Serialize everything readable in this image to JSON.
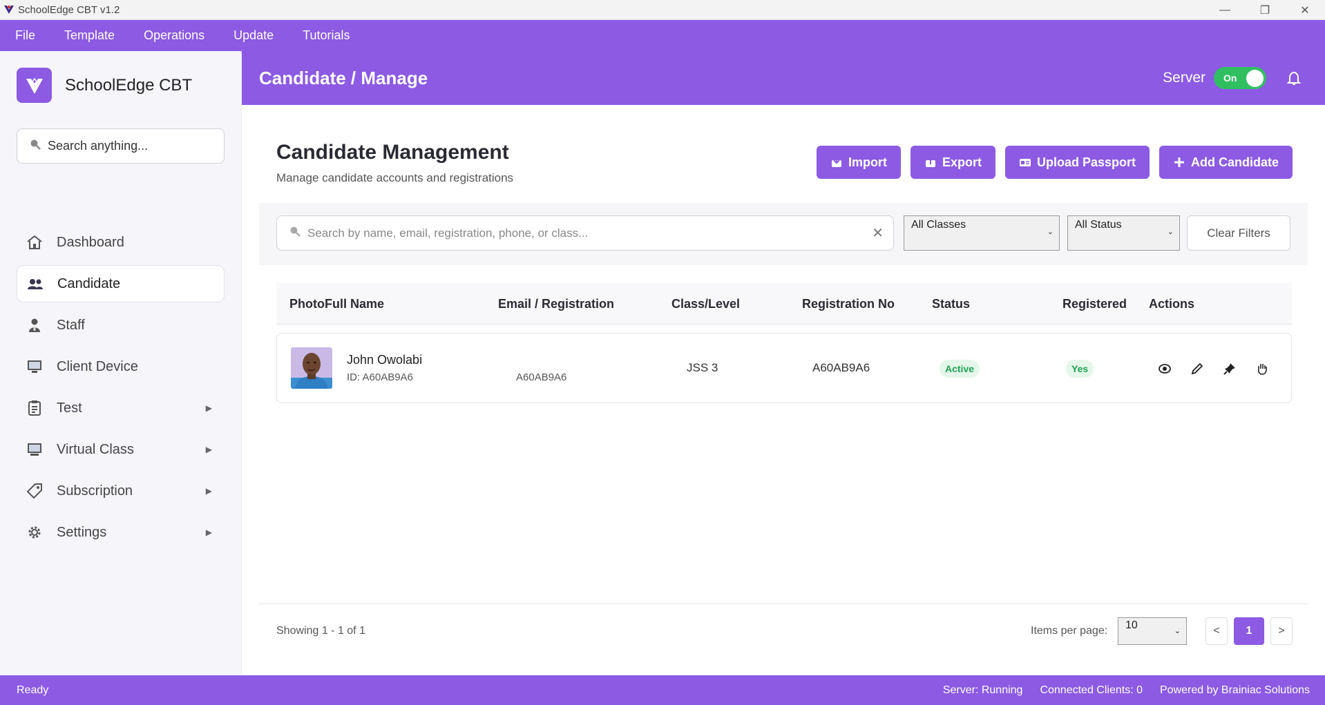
{
  "window": {
    "title": "SchoolEdge CBT v1.2",
    "controls": {
      "minimize": "—",
      "maximize": "❐",
      "close": "✕"
    }
  },
  "menu": [
    "File",
    "Template",
    "Operations",
    "Update",
    "Tutorials"
  ],
  "sidebar": {
    "brand": "SchoolEdge CBT",
    "search_placeholder": "Search anything...",
    "items": [
      {
        "label": "Dashboard",
        "icon": "home-icon",
        "has_submenu": false
      },
      {
        "label": "Candidate",
        "icon": "users-icon",
        "has_submenu": false,
        "active": true
      },
      {
        "label": "Staff",
        "icon": "staff-icon",
        "has_submenu": false
      },
      {
        "label": "Client Device",
        "icon": "monitor-icon",
        "has_submenu": false
      },
      {
        "label": "Test",
        "icon": "clipboard-icon",
        "has_submenu": true
      },
      {
        "label": "Virtual Class",
        "icon": "screen-icon",
        "has_submenu": true
      },
      {
        "label": "Subscription",
        "icon": "tag-icon",
        "has_submenu": true
      },
      {
        "label": "Settings",
        "icon": "gear-icon",
        "has_submenu": true
      }
    ],
    "submenu_arrow": "▶"
  },
  "header": {
    "title": "Candidate / Manage",
    "server_label": "Server",
    "toggle_text": "On"
  },
  "main": {
    "title": "Candidate Management",
    "subtitle": "Manage candidate accounts and registrations",
    "buttons": {
      "import": "Import",
      "export": "Export",
      "upload_passport": "Upload Passport",
      "add_candidate": "Add Candidate"
    },
    "filters": {
      "search_placeholder": "Search by name, email, registration, phone, or class...",
      "class_select": "All Classes",
      "status_select": "All Status",
      "clear": "Clear Filters"
    },
    "table": {
      "headers": [
        "PhotoFull Name",
        "Email / Registration",
        "Class/Level",
        "Registration No",
        "Status",
        "Registered",
        "Actions"
      ],
      "rows": [
        {
          "name": "John Owolabi",
          "id": "ID: A60AB9A6",
          "email_reg": "A60AB9A6",
          "class": "JSS 3",
          "reg_no": "A60AB9A6",
          "status": "Active",
          "registered": "Yes"
        }
      ]
    },
    "pagination": {
      "showing": "Showing 1  -  1  of  1",
      "items_per_page_label": "Items per page:",
      "items_per_page": "10",
      "prev": "<",
      "current": "1",
      "next": ">"
    }
  },
  "statusbar": {
    "ready": "Ready",
    "server": "Server: Running",
    "clients": "Connected Clients: 0",
    "powered": "Powered by Brainiac Solutions"
  },
  "colors": {
    "accent": "#8c5ae3",
    "success": "#2fbf61"
  }
}
